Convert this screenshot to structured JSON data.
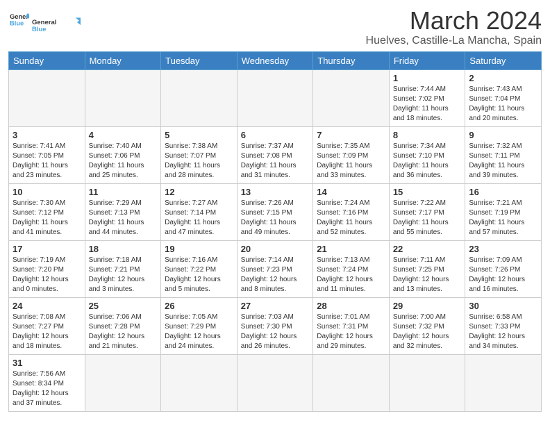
{
  "header": {
    "logo_general": "General",
    "logo_blue": "Blue",
    "month_title": "March 2024",
    "location": "Huelves, Castille-La Mancha, Spain"
  },
  "days_of_week": [
    "Sunday",
    "Monday",
    "Tuesday",
    "Wednesday",
    "Thursday",
    "Friday",
    "Saturday"
  ],
  "weeks": [
    [
      {
        "day": "",
        "info": ""
      },
      {
        "day": "",
        "info": ""
      },
      {
        "day": "",
        "info": ""
      },
      {
        "day": "",
        "info": ""
      },
      {
        "day": "",
        "info": ""
      },
      {
        "day": "1",
        "info": "Sunrise: 7:44 AM\nSunset: 7:02 PM\nDaylight: 11 hours and 18 minutes."
      },
      {
        "day": "2",
        "info": "Sunrise: 7:43 AM\nSunset: 7:04 PM\nDaylight: 11 hours and 20 minutes."
      }
    ],
    [
      {
        "day": "3",
        "info": "Sunrise: 7:41 AM\nSunset: 7:05 PM\nDaylight: 11 hours and 23 minutes."
      },
      {
        "day": "4",
        "info": "Sunrise: 7:40 AM\nSunset: 7:06 PM\nDaylight: 11 hours and 25 minutes."
      },
      {
        "day": "5",
        "info": "Sunrise: 7:38 AM\nSunset: 7:07 PM\nDaylight: 11 hours and 28 minutes."
      },
      {
        "day": "6",
        "info": "Sunrise: 7:37 AM\nSunset: 7:08 PM\nDaylight: 11 hours and 31 minutes."
      },
      {
        "day": "7",
        "info": "Sunrise: 7:35 AM\nSunset: 7:09 PM\nDaylight: 11 hours and 33 minutes."
      },
      {
        "day": "8",
        "info": "Sunrise: 7:34 AM\nSunset: 7:10 PM\nDaylight: 11 hours and 36 minutes."
      },
      {
        "day": "9",
        "info": "Sunrise: 7:32 AM\nSunset: 7:11 PM\nDaylight: 11 hours and 39 minutes."
      }
    ],
    [
      {
        "day": "10",
        "info": "Sunrise: 7:30 AM\nSunset: 7:12 PM\nDaylight: 11 hours and 41 minutes."
      },
      {
        "day": "11",
        "info": "Sunrise: 7:29 AM\nSunset: 7:13 PM\nDaylight: 11 hours and 44 minutes."
      },
      {
        "day": "12",
        "info": "Sunrise: 7:27 AM\nSunset: 7:14 PM\nDaylight: 11 hours and 47 minutes."
      },
      {
        "day": "13",
        "info": "Sunrise: 7:26 AM\nSunset: 7:15 PM\nDaylight: 11 hours and 49 minutes."
      },
      {
        "day": "14",
        "info": "Sunrise: 7:24 AM\nSunset: 7:16 PM\nDaylight: 11 hours and 52 minutes."
      },
      {
        "day": "15",
        "info": "Sunrise: 7:22 AM\nSunset: 7:17 PM\nDaylight: 11 hours and 55 minutes."
      },
      {
        "day": "16",
        "info": "Sunrise: 7:21 AM\nSunset: 7:19 PM\nDaylight: 11 hours and 57 minutes."
      }
    ],
    [
      {
        "day": "17",
        "info": "Sunrise: 7:19 AM\nSunset: 7:20 PM\nDaylight: 12 hours and 0 minutes."
      },
      {
        "day": "18",
        "info": "Sunrise: 7:18 AM\nSunset: 7:21 PM\nDaylight: 12 hours and 3 minutes."
      },
      {
        "day": "19",
        "info": "Sunrise: 7:16 AM\nSunset: 7:22 PM\nDaylight: 12 hours and 5 minutes."
      },
      {
        "day": "20",
        "info": "Sunrise: 7:14 AM\nSunset: 7:23 PM\nDaylight: 12 hours and 8 minutes."
      },
      {
        "day": "21",
        "info": "Sunrise: 7:13 AM\nSunset: 7:24 PM\nDaylight: 12 hours and 11 minutes."
      },
      {
        "day": "22",
        "info": "Sunrise: 7:11 AM\nSunset: 7:25 PM\nDaylight: 12 hours and 13 minutes."
      },
      {
        "day": "23",
        "info": "Sunrise: 7:09 AM\nSunset: 7:26 PM\nDaylight: 12 hours and 16 minutes."
      }
    ],
    [
      {
        "day": "24",
        "info": "Sunrise: 7:08 AM\nSunset: 7:27 PM\nDaylight: 12 hours and 18 minutes."
      },
      {
        "day": "25",
        "info": "Sunrise: 7:06 AM\nSunset: 7:28 PM\nDaylight: 12 hours and 21 minutes."
      },
      {
        "day": "26",
        "info": "Sunrise: 7:05 AM\nSunset: 7:29 PM\nDaylight: 12 hours and 24 minutes."
      },
      {
        "day": "27",
        "info": "Sunrise: 7:03 AM\nSunset: 7:30 PM\nDaylight: 12 hours and 26 minutes."
      },
      {
        "day": "28",
        "info": "Sunrise: 7:01 AM\nSunset: 7:31 PM\nDaylight: 12 hours and 29 minutes."
      },
      {
        "day": "29",
        "info": "Sunrise: 7:00 AM\nSunset: 7:32 PM\nDaylight: 12 hours and 32 minutes."
      },
      {
        "day": "30",
        "info": "Sunrise: 6:58 AM\nSunset: 7:33 PM\nDaylight: 12 hours and 34 minutes."
      }
    ],
    [
      {
        "day": "31",
        "info": "Sunrise: 7:56 AM\nSunset: 8:34 PM\nDaylight: 12 hours and 37 minutes."
      },
      {
        "day": "",
        "info": ""
      },
      {
        "day": "",
        "info": ""
      },
      {
        "day": "",
        "info": ""
      },
      {
        "day": "",
        "info": ""
      },
      {
        "day": "",
        "info": ""
      },
      {
        "day": "",
        "info": ""
      }
    ]
  ]
}
